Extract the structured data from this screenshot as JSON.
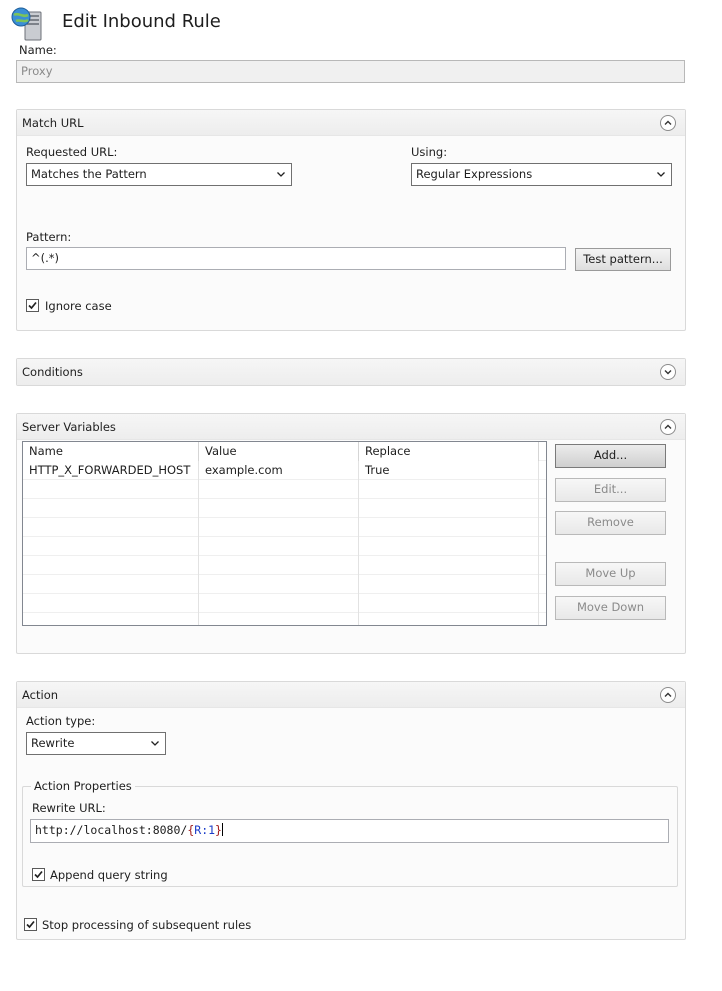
{
  "header": {
    "title": "Edit Inbound Rule",
    "icon": "server-globe-icon"
  },
  "name_field": {
    "label": "Name:",
    "value": "Proxy"
  },
  "match_url": {
    "title": "Match URL",
    "requested_url_label": "Requested URL:",
    "requested_url_value": "Matches the Pattern",
    "using_label": "Using:",
    "using_value": "Regular Expressions",
    "pattern_label": "Pattern:",
    "pattern_value": "^(.*)",
    "test_pattern_button": "Test pattern...",
    "ignore_case_label": "Ignore case",
    "ignore_case_checked": true
  },
  "conditions": {
    "title": "Conditions"
  },
  "server_variables": {
    "title": "Server Variables",
    "columns": [
      "Name",
      "Value",
      "Replace"
    ],
    "rows": [
      {
        "name": "HTTP_X_FORWARDED_HOST",
        "value": "example.com",
        "replace": "True"
      }
    ],
    "buttons": {
      "add": "Add...",
      "edit": "Edit...",
      "remove": "Remove",
      "move_up": "Move Up",
      "move_down": "Move Down"
    }
  },
  "action": {
    "title": "Action",
    "action_type_label": "Action type:",
    "action_type_value": "Rewrite",
    "properties_legend": "Action Properties",
    "rewrite_url_label": "Rewrite URL:",
    "rewrite_url_prefix": "http://localhost:8080/",
    "rewrite_url_brace_open": "{",
    "rewrite_url_var": "R:1",
    "rewrite_url_brace_close": "}",
    "append_query_label": "Append query string",
    "append_query_checked": true,
    "stop_processing_label": "Stop processing of subsequent rules",
    "stop_processing_checked": true
  }
}
